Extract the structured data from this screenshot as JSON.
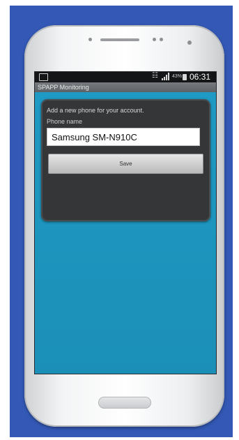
{
  "status_bar": {
    "battery_percent": "43%",
    "time": "06:31"
  },
  "app": {
    "title": "SPAPP Monitoring"
  },
  "dialog": {
    "message": "Add a new phone for your account.",
    "field_label": "Phone name",
    "phone_name_value": "Samsung SM-N910C",
    "save_label": "Save"
  },
  "colors": {
    "background_blue": "#3358b5",
    "content_blue": "#1f9ac4",
    "dialog_dark": "#343638"
  }
}
